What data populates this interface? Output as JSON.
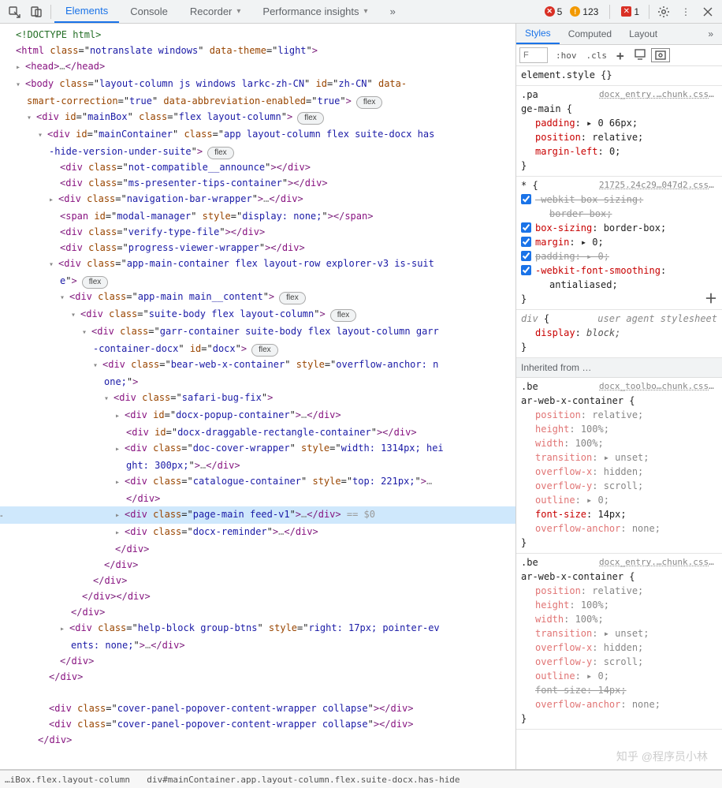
{
  "toolbar": {
    "tabs": [
      "Elements",
      "Console",
      "Recorder",
      "Performance insights"
    ],
    "active_tab": 0,
    "errors": "5",
    "warnings": "123",
    "issues": "1"
  },
  "dom": {
    "lines": [
      {
        "i": 0,
        "t": null,
        "h": "<span class='cmt'>&lt;!DOCTYPE html&gt;</span>"
      },
      {
        "i": 0,
        "t": null,
        "h": "<span class='punct'>&lt;</span><span class='tag'>html</span> <span class='attr'>class</span>=\"<span class='val'>notranslate windows</span>\" <span class='attr'>data-theme</span>=\"<span class='val'>light</span>\"<span class='punct'>&gt;</span>"
      },
      {
        "i": 1,
        "t": "closed",
        "h": "<span class='punct'>&lt;</span><span class='tag'>head</span><span class='punct'>&gt;</span><span class='gray'>…</span><span class='punct'>&lt;/</span><span class='tag'>head</span><span class='punct'>&gt;</span>"
      },
      {
        "i": 1,
        "t": "open",
        "h": "<span class='punct'>&lt;</span><span class='tag'>body</span> <span class='attr'>class</span>=\"<span class='val'>layout-column js windows larkc-zh-CN</span>\" <span class='attr'>id</span>=\"<span class='val'>zh-CN</span>\" <span class='attr'>data-</span>"
      },
      {
        "i": 1,
        "t": null,
        "h": "<span class='attr'>smart-correction</span>=\"<span class='val'>true</span>\" <span class='attr'>data-abbreviation-enabled</span>=\"<span class='val'>true</span>\"<span class='punct'>&gt;</span><span class='badge'>flex</span>"
      },
      {
        "i": 2,
        "t": "open",
        "h": "<span class='punct'>&lt;</span><span class='tag'>div</span> <span class='attr'>id</span>=\"<span class='val'>mainBox</span>\" <span class='attr'>class</span>=\"<span class='val'>flex layout-column</span>\"<span class='punct'>&gt;</span><span class='badge'>flex</span>"
      },
      {
        "i": 3,
        "t": "open",
        "h": "<span class='punct'>&lt;</span><span class='tag'>div</span> <span class='attr'>id</span>=\"<span class='val'>mainContainer</span>\" <span class='attr'>class</span>=\"<span class='val'>app layout-column flex suite-docx has</span>"
      },
      {
        "i": 3,
        "t": null,
        "h": "<span class='val'>-hide-version-under-suite</span>\"<span class='punct'>&gt;</span><span class='badge'>flex</span>"
      },
      {
        "i": 4,
        "t": null,
        "h": "<span class='punct'>&lt;</span><span class='tag'>div</span> <span class='attr'>class</span>=\"<span class='val'>not-compatible__announce</span>\"<span class='punct'>&gt;&lt;/</span><span class='tag'>div</span><span class='punct'>&gt;</span>"
      },
      {
        "i": 4,
        "t": null,
        "h": "<span class='punct'>&lt;</span><span class='tag'>div</span> <span class='attr'>class</span>=\"<span class='val'>ms-presenter-tips-container</span>\"<span class='punct'>&gt;&lt;/</span><span class='tag'>div</span><span class='punct'>&gt;</span>"
      },
      {
        "i": 4,
        "t": "closed",
        "h": "<span class='punct'>&lt;</span><span class='tag'>div</span> <span class='attr'>class</span>=\"<span class='val'>navigation-bar-wrapper</span>\"<span class='punct'>&gt;</span><span class='gray'>…</span><span class='punct'>&lt;/</span><span class='tag'>div</span><span class='punct'>&gt;</span>"
      },
      {
        "i": 4,
        "t": null,
        "h": "<span class='punct'>&lt;</span><span class='tag'>span</span> <span class='attr'>id</span>=\"<span class='val'>modal-manager</span>\" <span class='attr'>style</span>=\"<span class='val'>display: none;</span>\"<span class='punct'>&gt;&lt;/</span><span class='tag'>span</span><span class='punct'>&gt;</span>"
      },
      {
        "i": 4,
        "t": null,
        "h": "<span class='punct'>&lt;</span><span class='tag'>div</span> <span class='attr'>class</span>=\"<span class='val'>verify-type-file</span>\"<span class='punct'>&gt;&lt;/</span><span class='tag'>div</span><span class='punct'>&gt;</span>"
      },
      {
        "i": 4,
        "t": null,
        "h": "<span class='punct'>&lt;</span><span class='tag'>div</span> <span class='attr'>class</span>=\"<span class='val'>progress-viewer-wrapper</span>\"<span class='punct'>&gt;&lt;/</span><span class='tag'>div</span><span class='punct'>&gt;</span>"
      },
      {
        "i": 4,
        "t": "open",
        "h": "<span class='punct'>&lt;</span><span class='tag'>div</span> <span class='attr'>class</span>=\"<span class='val'>app-main-container flex layout-row explorer-v3 is-suit</span>"
      },
      {
        "i": 4,
        "t": null,
        "h": "<span class='val'>e</span>\"<span class='punct'>&gt;</span><span class='badge'>flex</span>"
      },
      {
        "i": 5,
        "t": "open",
        "h": "<span class='punct'>&lt;</span><span class='tag'>div</span> <span class='attr'>class</span>=\"<span class='val'>app-main main__content</span>\"<span class='punct'>&gt;</span><span class='badge'>flex</span>"
      },
      {
        "i": 6,
        "t": "open",
        "h": "<span class='punct'>&lt;</span><span class='tag'>div</span> <span class='attr'>class</span>=\"<span class='val'>suite-body flex layout-column</span>\"<span class='punct'>&gt;</span><span class='badge'>flex</span>"
      },
      {
        "i": 7,
        "t": "open",
        "h": "<span class='punct'>&lt;</span><span class='tag'>div</span> <span class='attr'>class</span>=\"<span class='val'>garr-container suite-body flex layout-column garr</span>"
      },
      {
        "i": 7,
        "t": null,
        "h": "<span class='val'>-container-docx</span>\" <span class='attr'>id</span>=\"<span class='val'>docx</span>\"<span class='punct'>&gt;</span><span class='badge'>flex</span>"
      },
      {
        "i": 8,
        "t": "open",
        "h": "<span class='punct'>&lt;</span><span class='tag'>div</span> <span class='attr'>class</span>=\"<span class='val'>bear-web-x-container</span>\" <span class='attr'>style</span>=\"<span class='val'>overflow-anchor: n</span>"
      },
      {
        "i": 8,
        "t": null,
        "h": "<span class='val'>one;</span>\"<span class='punct'>&gt;</span>"
      },
      {
        "i": 9,
        "t": "open",
        "h": "<span class='punct'>&lt;</span><span class='tag'>div</span> <span class='attr'>class</span>=\"<span class='val'>safari-bug-fix</span>\"<span class='punct'>&gt;</span>"
      },
      {
        "i": 10,
        "t": "closed",
        "h": "<span class='punct'>&lt;</span><span class='tag'>div</span> <span class='attr'>id</span>=\"<span class='val'>docx-popup-container</span>\"<span class='punct'>&gt;</span><span class='gray'>…</span><span class='punct'>&lt;/</span><span class='tag'>div</span><span class='punct'>&gt;</span>"
      },
      {
        "i": 10,
        "t": null,
        "h": "<span class='punct'>&lt;</span><span class='tag'>div</span> <span class='attr'>id</span>=\"<span class='val'>docx-draggable-rectangle-container</span>\"<span class='punct'>&gt;&lt;/</span><span class='tag'>div</span><span class='punct'>&gt;</span>"
      },
      {
        "i": 10,
        "t": "closed",
        "h": "<span class='punct'>&lt;</span><span class='tag'>div</span> <span class='attr'>class</span>=\"<span class='val'>doc-cover-wrapper</span>\" <span class='attr'>style</span>=\"<span class='val'>width: 1314px; hei</span>"
      },
      {
        "i": 10,
        "t": null,
        "h": "<span class='val'>ght: 300px;</span>\"<span class='punct'>&gt;</span><span class='gray'>…</span><span class='punct'>&lt;/</span><span class='tag'>div</span><span class='punct'>&gt;</span>"
      },
      {
        "i": 10,
        "t": "closed",
        "h": "<span class='punct'>&lt;</span><span class='tag'>div</span> <span class='attr'>class</span>=\"<span class='val'>catalogue-container</span>\" <span class='attr'>style</span>=\"<span class='val'>top: 221px;</span>\"<span class='punct'>&gt;</span><span class='gray'>…</span>"
      },
      {
        "i": 10,
        "t": null,
        "h": "<span class='punct'>&lt;/</span><span class='tag'>div</span><span class='punct'>&gt;</span>"
      },
      {
        "i": 10,
        "t": "closed",
        "hl": true,
        "h": "<span class='punct'>&lt;</span><span class='tag'>div</span> <span class='attr'>class</span>=\"<span class='val'>page-main feed-v1</span>\"<span class='punct'>&gt;</span><span class='gray'>…</span><span class='punct'>&lt;/</span><span class='tag'>div</span><span class='punct'>&gt;</span> <span class='sel-hint'>== $0</span>"
      },
      {
        "i": 10,
        "t": "closed",
        "h": "<span class='punct'>&lt;</span><span class='tag'>div</span> <span class='attr'>class</span>=\"<span class='val'>docx-reminder</span>\"<span class='punct'>&gt;</span><span class='gray'>…</span><span class='punct'>&lt;/</span><span class='tag'>div</span><span class='punct'>&gt;</span>"
      },
      {
        "i": 9,
        "t": null,
        "h": "<span class='punct'>&lt;/</span><span class='tag'>div</span><span class='punct'>&gt;</span>"
      },
      {
        "i": 8,
        "t": null,
        "h": "<span class='punct'>&lt;/</span><span class='tag'>div</span><span class='punct'>&gt;</span>"
      },
      {
        "i": 7,
        "t": null,
        "h": "<span class='punct'>&lt;/</span><span class='tag'>div</span><span class='punct'>&gt;</span>"
      },
      {
        "i": 6,
        "t": null,
        "h": "<span class='punct'>&lt;/</span><span class='tag'>div</span><span class='punct'>&gt;&lt;/</span><span class='tag'>div</span><span class='punct'>&gt;</span>"
      },
      {
        "i": 5,
        "t": null,
        "h": "<span class='punct'>&lt;/</span><span class='tag'>div</span><span class='punct'>&gt;</span>"
      },
      {
        "i": 5,
        "t": "closed",
        "h": "<span class='punct'>&lt;</span><span class='tag'>div</span> <span class='attr'>class</span>=\"<span class='val'>help-block group-btns</span>\" <span class='attr'>style</span>=\"<span class='val'>right: 17px; pointer-ev</span>"
      },
      {
        "i": 5,
        "t": null,
        "h": "<span class='val'>ents: none;</span>\"<span class='punct'>&gt;</span><span class='gray'>…</span><span class='punct'>&lt;/</span><span class='tag'>div</span><span class='punct'>&gt;</span>"
      },
      {
        "i": 4,
        "t": null,
        "h": "<span class='punct'>&lt;/</span><span class='tag'>div</span><span class='punct'>&gt;</span>"
      },
      {
        "i": 3,
        "t": null,
        "h": "<span class='punct'>&lt;/</span><span class='tag'>div</span><span class='punct'>&gt;</span>"
      },
      {
        "i": 3,
        "t": null,
        "h": ""
      },
      {
        "i": 3,
        "t": null,
        "h": "<span class='punct'>&lt;</span><span class='tag'>div</span> <span class='attr'>class</span>=\"<span class='val'>cover-panel-popover-content-wrapper collapse</span>\"<span class='punct'>&gt;&lt;/</span><span class='tag'>div</span><span class='punct'>&gt;</span>"
      },
      {
        "i": 3,
        "t": null,
        "h": "<span class='punct'>&lt;</span><span class='tag'>div</span> <span class='attr'>class</span>=\"<span class='val'>cover-panel-popover-content-wrapper collapse</span>\"<span class='punct'>&gt;&lt;/</span><span class='tag'>div</span><span class='punct'>&gt;</span>"
      },
      {
        "i": 2,
        "t": null,
        "h": "<span class='punct'>&lt;/</span><span class='tag'>div</span><span class='punct'>&gt;</span>"
      }
    ]
  },
  "styles": {
    "tabs": [
      "Styles",
      "Computed",
      "Layout"
    ],
    "filter_placeholder": "F",
    "hov_label": ":hov",
    "cls_label": ".cls",
    "rules": [
      {
        "selector": "element.style",
        "src": "",
        "decls": [],
        "brace": true
      },
      {
        "selector": ".page-main",
        "src": "docx_entry.…chunk.css:1",
        "wrap_sel": ".pa  ",
        "sel2": "",
        "tail": " {",
        "decls": [
          {
            "p": "padding",
            "v": "▸ 0 66px;"
          },
          {
            "p": "position",
            "v": "relative;"
          },
          {
            "p": "margin-left",
            "v": "0;"
          }
        ]
      },
      {
        "selector": "*",
        "src": "21725.24c29…047d2.css:1",
        "tail": " {",
        "decls": [
          {
            "chk": true,
            "strike": true,
            "p": "-webkit-box-sizing",
            "v": ""
          },
          {
            "cont": true,
            "strike": true,
            "v": "border-box;"
          },
          {
            "chk": true,
            "p": "box-sizing",
            "v": "border-box;"
          },
          {
            "chk": true,
            "p": "margin",
            "v": "▸ 0;"
          },
          {
            "chk": true,
            "strike": true,
            "p": "padding",
            "v": "▸ 0;"
          },
          {
            "chk": true,
            "p": "-webkit-font-smoothing",
            "v": ""
          },
          {
            "cont": true,
            "v": "antialiased;"
          }
        ],
        "add": true
      },
      {
        "selector": "div",
        "src": "",
        "ua": "user agent stylesheet",
        "tail": " {",
        "decls": [
          {
            "p": "display",
            "v": "block;",
            "ital": true
          }
        ]
      },
      {
        "inherited": "Inherited from …"
      },
      {
        "selector": ".bear-web-x-container",
        "src": "docx_toolbo…chunk.css:1",
        "wrap_sel": ".be  ",
        "tail": " {",
        "decls": [
          {
            "p": "position",
            "v": "relative;",
            "dim": true
          },
          {
            "p": "height",
            "v": "100%;",
            "dim": true
          },
          {
            "p": "width",
            "v": "100%;",
            "dim": true
          },
          {
            "p": "transition",
            "v": "▸ unset;",
            "dim": true
          },
          {
            "p": "overflow-x",
            "v": "hidden;",
            "dim": true
          },
          {
            "p": "overflow-y",
            "v": "scroll;",
            "dim": true
          },
          {
            "p": "outline",
            "v": "▸ 0;",
            "dim": true
          },
          {
            "p": "font-size",
            "v": "14px;"
          },
          {
            "p": "overflow-anchor",
            "v": "none;",
            "dim": true
          }
        ]
      },
      {
        "selector": ".bear-web-x-container",
        "src": "docx_entry.…chunk.css:1",
        "wrap_sel": ".be  ",
        "tail": " {",
        "decls": [
          {
            "p": "position",
            "v": "relative;",
            "dim": true
          },
          {
            "p": "height",
            "v": "100%;",
            "dim": true
          },
          {
            "p": "width",
            "v": "100%;",
            "dim": true
          },
          {
            "p": "transition",
            "v": "▸ unset;",
            "dim": true
          },
          {
            "p": "overflow-x",
            "v": "hidden;",
            "dim": true
          },
          {
            "p": "overflow-y",
            "v": "scroll;",
            "dim": true
          },
          {
            "p": "outline",
            "v": "▸ 0;",
            "dim": true
          },
          {
            "p": "font-size",
            "v": "14px;",
            "strike": true
          },
          {
            "p": "overflow-anchor",
            "v": "none;",
            "dim": true
          }
        ]
      }
    ]
  },
  "crumbs": [
    "…",
    "iBox.flex.layout-column",
    "div#mainContainer.app.layout-column.flex.suite-docx.has-hide"
  ],
  "watermark": "知乎 @程序员小林"
}
